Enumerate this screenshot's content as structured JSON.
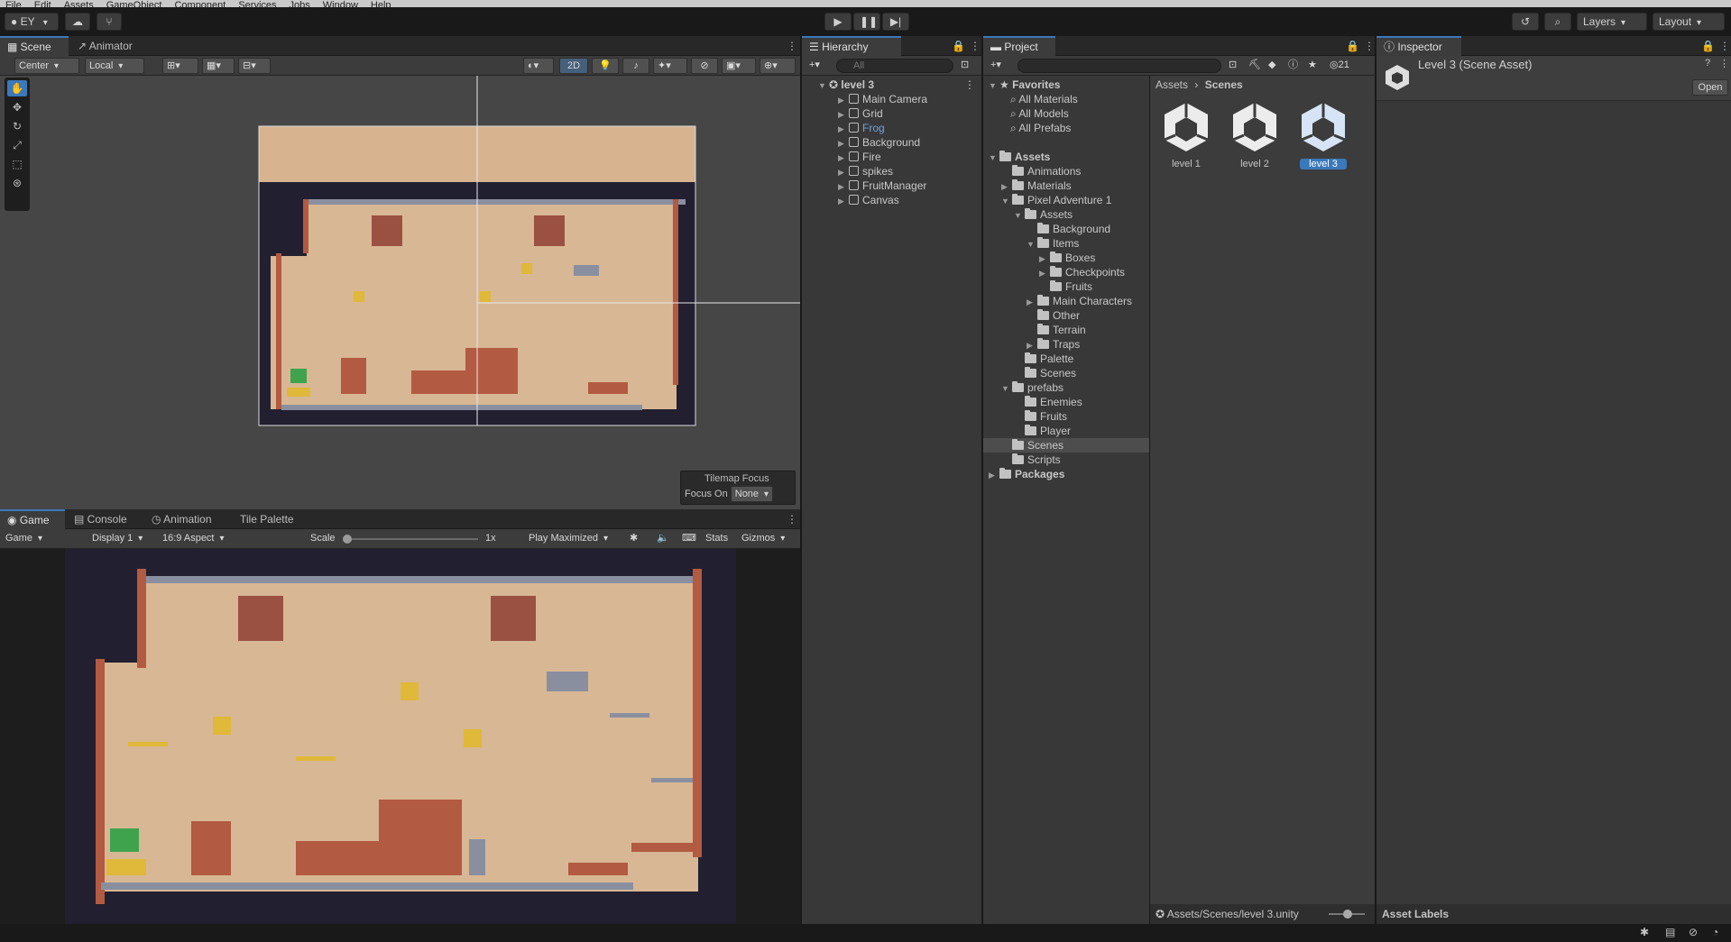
{
  "menu": [
    "File",
    "Edit",
    "Assets",
    "GameObject",
    "Component",
    "Services",
    "Jobs",
    "Window",
    "Help"
  ],
  "toolbar": {
    "account": "EY",
    "layers": "Layers",
    "layout": "Layout"
  },
  "scene": {
    "tabs": [
      "Scene",
      "Animator"
    ],
    "pivot": "Center",
    "space": "Local",
    "mode_2d": "2D",
    "tilemap_focus_title": "Tilemap Focus",
    "focus_on_label": "Focus On",
    "focus_value": "None"
  },
  "game": {
    "tabs": [
      "Game",
      "Console",
      "Animation",
      "Tile Palette"
    ],
    "view": "Game",
    "display": "Display 1",
    "aspect": "16:9 Aspect",
    "scale_label": "Scale",
    "scale_value": "1x",
    "play_mode": "Play Maximized",
    "stats": "Stats",
    "gizmos": "Gizmos"
  },
  "hierarchy": {
    "tab": "Hierarchy",
    "search_placeholder": "All",
    "root": "level 3",
    "items": [
      "Main Camera",
      "Grid",
      "Frog",
      "Background",
      "Fire",
      "spikes",
      "FruitManager",
      "Canvas"
    ]
  },
  "project": {
    "tab": "Project",
    "hidden_count": "21",
    "favorites": {
      "label": "Favorites",
      "items": [
        "All Materials",
        "All Models",
        "All Prefabs"
      ]
    },
    "tree": [
      {
        "label": "Assets",
        "depth": 0,
        "arrow": "▼",
        "bold": true
      },
      {
        "label": "Animations",
        "depth": 1,
        "arrow": ""
      },
      {
        "label": "Materials",
        "depth": 1,
        "arrow": "▶"
      },
      {
        "label": "Pixel Adventure 1",
        "depth": 1,
        "arrow": "▼"
      },
      {
        "label": "Assets",
        "depth": 2,
        "arrow": "▼"
      },
      {
        "label": "Background",
        "depth": 3,
        "arrow": ""
      },
      {
        "label": "Items",
        "depth": 3,
        "arrow": "▼"
      },
      {
        "label": "Boxes",
        "depth": 4,
        "arrow": "▶"
      },
      {
        "label": "Checkpoints",
        "depth": 4,
        "arrow": "▶"
      },
      {
        "label": "Fruits",
        "depth": 4,
        "arrow": ""
      },
      {
        "label": "Main Characters",
        "depth": 3,
        "arrow": "▶"
      },
      {
        "label": "Other",
        "depth": 3,
        "arrow": ""
      },
      {
        "label": "Terrain",
        "depth": 3,
        "arrow": ""
      },
      {
        "label": "Traps",
        "depth": 3,
        "arrow": "▶"
      },
      {
        "label": "Palette",
        "depth": 2,
        "arrow": ""
      },
      {
        "label": "Scenes",
        "depth": 2,
        "arrow": ""
      },
      {
        "label": "prefabs",
        "depth": 1,
        "arrow": "▼"
      },
      {
        "label": "Enemies",
        "depth": 2,
        "arrow": ""
      },
      {
        "label": "Fruits",
        "depth": 2,
        "arrow": ""
      },
      {
        "label": "Player",
        "depth": 2,
        "arrow": ""
      },
      {
        "label": "Scenes",
        "depth": 1,
        "arrow": "",
        "selected": true
      },
      {
        "label": "Scripts",
        "depth": 1,
        "arrow": ""
      },
      {
        "label": "Packages",
        "depth": 0,
        "arrow": "▶",
        "bold": true
      }
    ],
    "breadcrumb": [
      "Assets",
      "Scenes"
    ],
    "assets": [
      "level 1",
      "level 2",
      "level 3"
    ],
    "selected_asset": "level 3",
    "footer_path": "Assets/Scenes/level 3.unity"
  },
  "inspector": {
    "tab": "Inspector",
    "title": "Level 3 (Scene Asset)",
    "open_button": "Open",
    "asset_labels": "Asset Labels"
  },
  "colors": {
    "accent": "#3a79bb",
    "panel": "#383838",
    "scene_sky": "#d7b390",
    "scene_wall": "#211f30"
  }
}
